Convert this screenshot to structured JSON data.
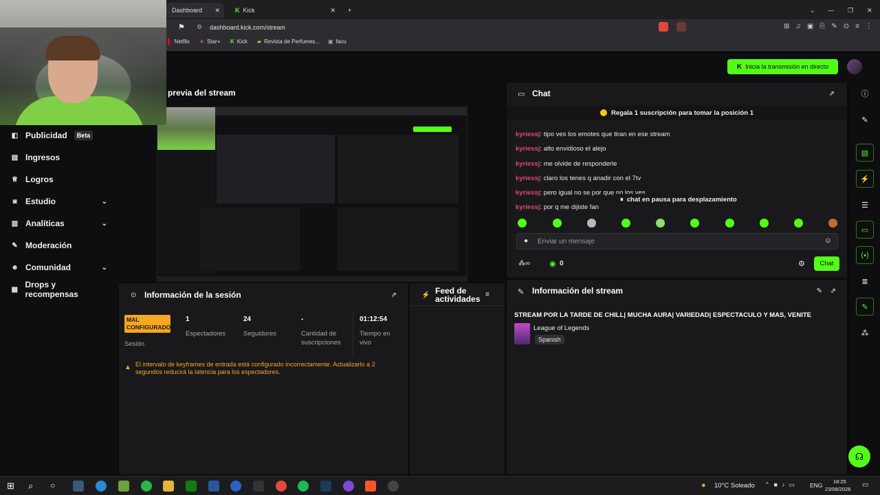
{
  "browser": {
    "tabs": [
      {
        "label": "Dashboard"
      },
      {
        "label": "Kick"
      }
    ],
    "url": "dashboard.kick.com/stream",
    "bookmarks": [
      "Netflix",
      "Star+",
      "Kick",
      "Revista de Perfumes...",
      "facu"
    ]
  },
  "header": {
    "go_live_label": "Inicia la transmisión en directo"
  },
  "sidebar": {
    "items": [
      {
        "label": "Publicidad",
        "badge": "Beta",
        "icon": "megaphone-icon"
      },
      {
        "label": "Ingresos",
        "icon": "wallet-icon"
      },
      {
        "label": "Logros",
        "icon": "trophy-icon"
      },
      {
        "label": "Estudio",
        "icon": "camera-icon",
        "expandable": true
      },
      {
        "label": "Analíticas",
        "icon": "chart-icon",
        "expandable": true
      },
      {
        "label": "Moderación",
        "icon": "wrench-icon"
      },
      {
        "label": "Comunidad",
        "icon": "people-icon",
        "expandable": true
      },
      {
        "label": "Drops y recompensas",
        "icon": "gift-icon"
      }
    ]
  },
  "preview": {
    "title": "previa del stream"
  },
  "session": {
    "title": "Información de la sesión",
    "status_badge": "MAL CONFIGURADO",
    "status_label": "Sesión",
    "stats": [
      {
        "value": "1",
        "label": "Espectadores"
      },
      {
        "value": "24",
        "label": "Seguidores"
      },
      {
        "value": "-",
        "label": "Cantidad de suscripciones"
      },
      {
        "value": "01:12:54",
        "label": "Tiempo en vivo"
      }
    ],
    "warning": "El intervalo de keyframes de entrada está configurado incorrectamente. Actualizarlo a 2 segundos reducirá la latencia para los espectadores."
  },
  "feed": {
    "title": "Feed de actividades"
  },
  "chat": {
    "title": "Chat",
    "pinned": "Regala 1 suscripción para tomar la posición 1",
    "messages": [
      {
        "user": "kyriessj",
        "text": "tipo ves los emotes que tiran en ese stream"
      },
      {
        "user": "kyriessj",
        "text": "alto envidioso el alejo"
      },
      {
        "user": "kyriessj",
        "text": "me olvide de responderle"
      },
      {
        "user": "kyriessj",
        "text": "claro los tenes q anadir con el 7tv"
      },
      {
        "user": "kyriessj",
        "text": "pero igual no se por que no los ves"
      },
      {
        "user": "kyriessj",
        "text": "por q me dijiste fan"
      }
    ],
    "paused_label": "chat en pausa para desplazamiento",
    "input_placeholder": "Enviar un mensaje",
    "count": "0",
    "send_label": "Chat"
  },
  "stream_info": {
    "title": "Información del stream",
    "stream_title": "STREAM POR LA TARDE DE CHILL| MUCHA AURA| VARIEDAD| ESPECTACULO Y MAS, VENITE",
    "category": "League of Legends",
    "language": "Spanish"
  },
  "taskbar": {
    "weather": "10°C Soleado",
    "lang": "ENG",
    "time": "18:25",
    "date": "23/08/2026"
  },
  "colors": {
    "accent": "#53fc18",
    "warning": "#f5a623",
    "username": "#e0496b"
  }
}
